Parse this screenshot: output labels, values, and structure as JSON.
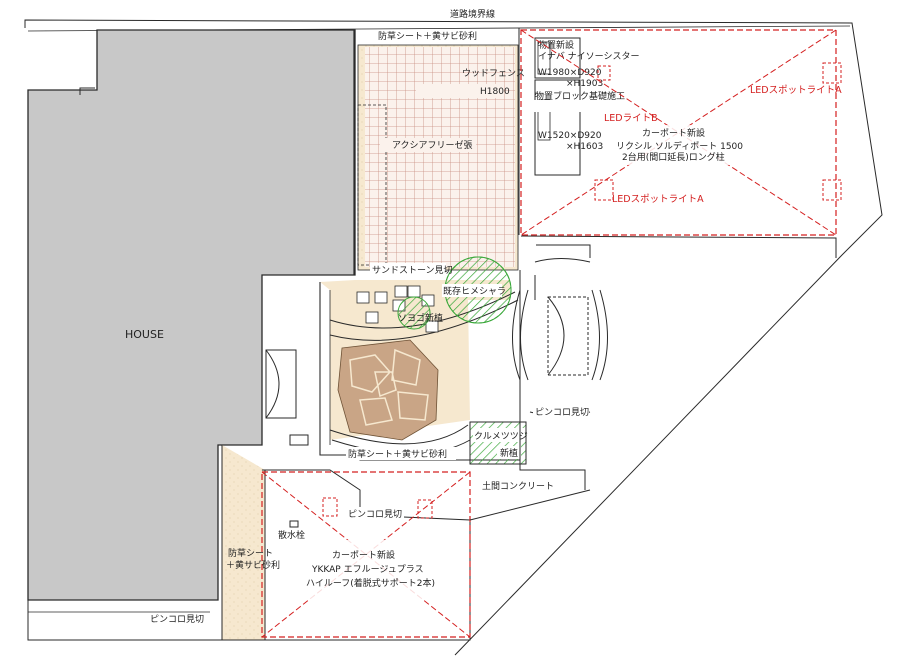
{
  "labels": {
    "road_boundary": "道路境界線",
    "house": "HOUSE",
    "weed_sheet_top": "防草シート＋黄サビ砂利",
    "wood_fence": "ウッドフェンス",
    "wood_fence_h": "H1800",
    "acacia": "アクシアフリーゼ張",
    "sandstone": "サンドストーン見切",
    "existing_tree": "既存ヒメシャラ",
    "soyogo": "ソヨゴ新植",
    "weed_sheet_mid": "防草シート＋黄サビ砂利",
    "kurume": "クルメツツジ",
    "kurume_new": "新植",
    "pinkoro_right": "ピンコロ見切",
    "doma": "土間コンクリート",
    "pinkoro_mid": "ピンコロ見切",
    "faucet": "散水栓",
    "weed_sheet_left_1": "防草シート",
    "weed_sheet_left_2": "＋黄サビ砂利",
    "pinkoro_bottom": "ピンコロ見切",
    "storage_new": "物置新設",
    "storage_model": "イナバ ナイソーシスター",
    "storage_size1": "W1980×D920",
    "storage_size1_h": "×H1903",
    "storage_base": "物置ブロック基礎施工",
    "storage_size2": "W1520×D920",
    "storage_size2_h": "×H1603",
    "led_b": "LEDライトB",
    "led_a_top": "LEDスポットライトA",
    "led_a_mid": "LEDスポットライトA",
    "carport_right_title": "カーポート新設",
    "carport_right_model": "リクシル ソルディポート 1500",
    "carport_right_detail": "2台用(間口延長)ロング柱",
    "carport_left_title": "カーポート新設",
    "carport_left_model": "YKKAP エフルージュプラス",
    "carport_left_detail": "ハイルーフ(着脱式サポート2本)"
  },
  "colors": {
    "line": "#2a2a2a",
    "house_fill": "#c8c8c8",
    "sand_fill": "#f6e8cf",
    "tile_line": "#c88f80",
    "stone_fill": "#c9a586",
    "red": "#d42020",
    "green": "#3aa83a"
  }
}
